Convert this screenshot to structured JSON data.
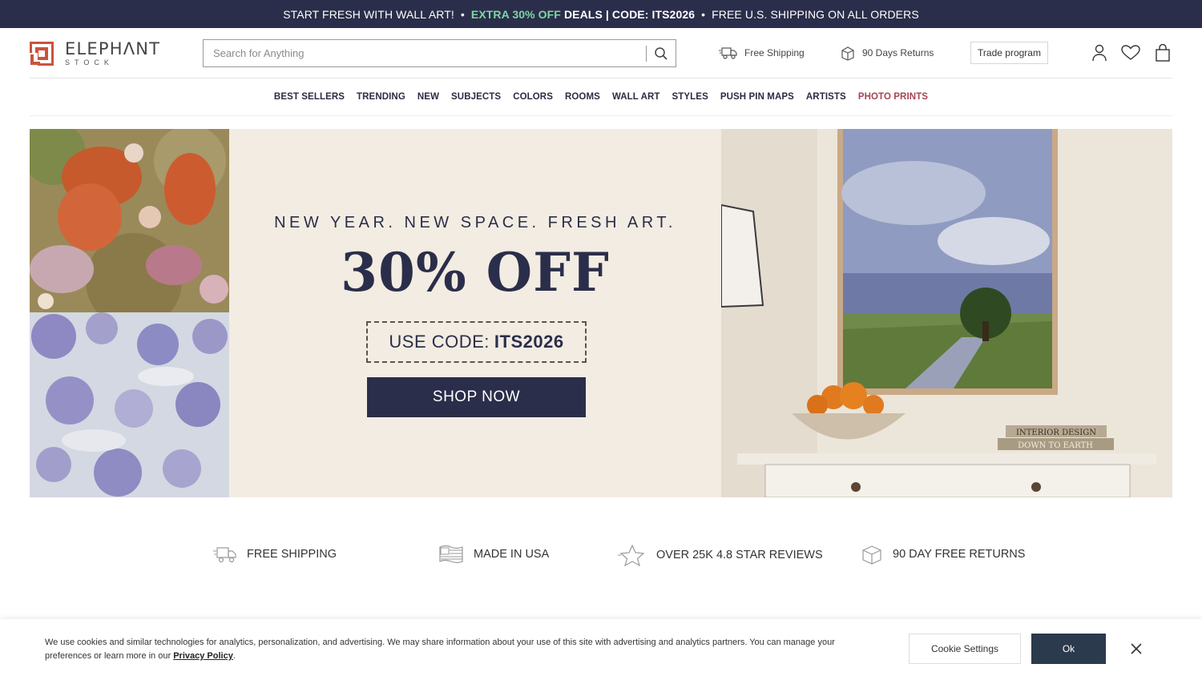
{
  "promo": {
    "part1": "START FRESH WITH WALL ART!",
    "sep1": "•",
    "highlight": "EXTRA 30% OFF",
    "deals": "DEALS | CODE: ITS2026",
    "sep2": "•",
    "part3": "FREE U.S. SHIPPING ON ALL ORDERS",
    "bg_color": "#2b2e4a",
    "highlight_color": "#7ed6a5"
  },
  "header": {
    "logo_word": "ELEPHΛNT",
    "logo_sub": "STOCK",
    "search_placeholder": "Search for Anything",
    "free_shipping": "Free Shipping",
    "returns": "90 Days Returns",
    "trade": "Trade program",
    "icons": [
      "account-icon",
      "heart-icon",
      "bag-icon"
    ]
  },
  "nav": {
    "items": [
      "BEST SELLERS",
      "TRENDING",
      "NEW",
      "SUBJECTS",
      "COLORS",
      "ROOMS",
      "WALL ART",
      "STYLES",
      "PUSH PIN MAPS",
      "ARTISTS",
      "PHOTO PRINTS"
    ],
    "highlight_color": "#a84452"
  },
  "hero": {
    "tagline": "NEW YEAR. NEW SPACE. FRESH ART.",
    "headline": "30% OFF",
    "code_label": "USE CODE:",
    "code_value": "ITS2026",
    "cta": "SHOP NOW",
    "book_line1": "INTERIOR DESIGN",
    "book_line2": "DOWN TO EARTH"
  },
  "usps": [
    {
      "icon": "truck-icon",
      "label": "FREE SHIPPING"
    },
    {
      "icon": "flag-icon",
      "label": "MADE IN USA"
    },
    {
      "icon": "star-icon",
      "label": "OVER 25K 4.8 STAR REVIEWS"
    },
    {
      "icon": "return-box-icon",
      "label": "90 DAY FREE RETURNS"
    }
  ],
  "cookie": {
    "text": "We use cookies and similar technologies for analytics, personalization, and advertising. We may share information about your use of this site with advertising and analytics partners. You can manage your preferences or learn more in our",
    "link": "Privacy Policy",
    "period": ".",
    "settings": "Cookie Settings",
    "ok": "Ok"
  }
}
